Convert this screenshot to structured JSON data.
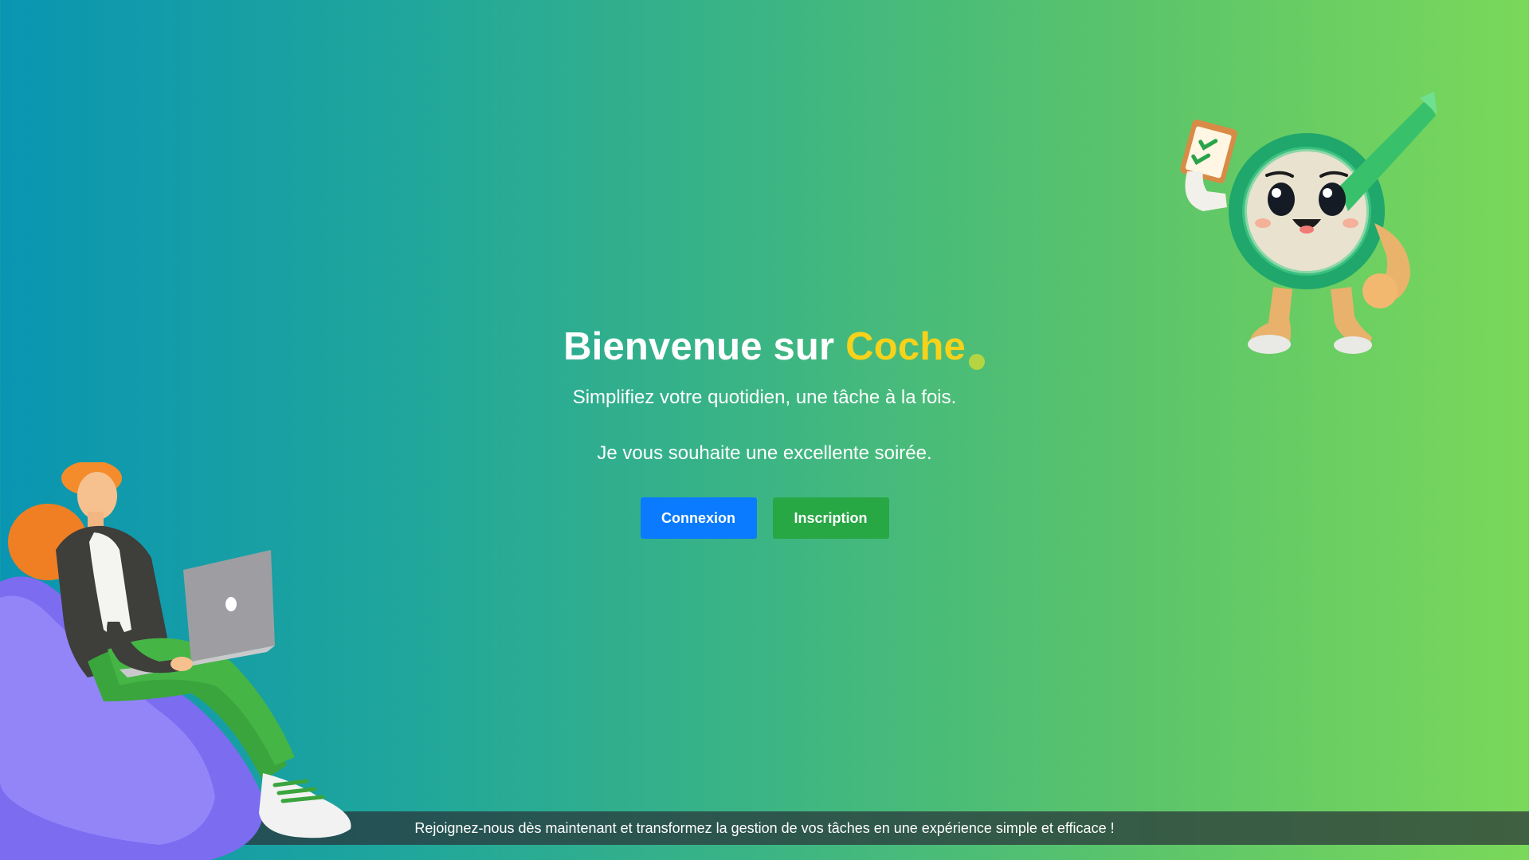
{
  "hero": {
    "title_prefix": "Bienvenue sur ",
    "title_brand": "Coche",
    "subtitle": "Simplifiez votre quotidien, une tâche à la fois.",
    "greeting": "Je vous souhaite une excellente soirée."
  },
  "actions": {
    "login_label": "Connexion",
    "signup_label": "Inscription"
  },
  "footer": {
    "text": "Rejoignez-nous dès maintenant et transformez la gestion de vos tâches en une expérience simple et efficace !"
  },
  "colors": {
    "brand_accent": "#f7d21a",
    "login_button": "#0a7bff",
    "signup_button": "#28a745"
  },
  "illustrations": {
    "left": "woman-with-laptop-illustration",
    "right": "checkmark-mascot-illustration"
  }
}
